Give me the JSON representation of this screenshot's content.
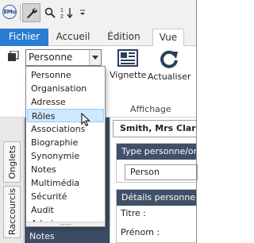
{
  "qat": {
    "logo_text": "EMu",
    "icons": [
      "wrench-icon",
      "search-icon",
      "sort-az-icon",
      "customize-dropdown-icon"
    ]
  },
  "ribbon": {
    "file_tab": "Fichier",
    "tabs": [
      "Accueil",
      "Édition",
      "Vue"
    ],
    "active_tab": "Vue",
    "module_select_value": "Personne",
    "view_button_label": "Vignette",
    "refresh_button_label": "Actualiser",
    "group_label": "Affichage"
  },
  "dropdown": {
    "options": [
      "Personne",
      "Organisation",
      "Adresse",
      "Rôles",
      "Associations",
      "Biographie",
      "Synonymie",
      "Notes",
      "Multimédia",
      "Sécurité",
      "Audit",
      "Admin"
    ],
    "hovered": "Rôles"
  },
  "sidebar": {
    "tabs": [
      "Onglets",
      "Raccourcis"
    ]
  },
  "leftpane": {
    "visible_item": "Notes"
  },
  "record": {
    "name": "Smith, Mrs Clare",
    "panel1_title": "Type personne/organisation",
    "panel1_value": "Person",
    "panel2_title": "Détails personnels",
    "fields": [
      "Titre :",
      "Prénom :"
    ]
  },
  "colors": {
    "file_tab_blue": "#2b7cd3",
    "panel_header": "#3f5068",
    "hover_blue": "#cde8ff"
  }
}
